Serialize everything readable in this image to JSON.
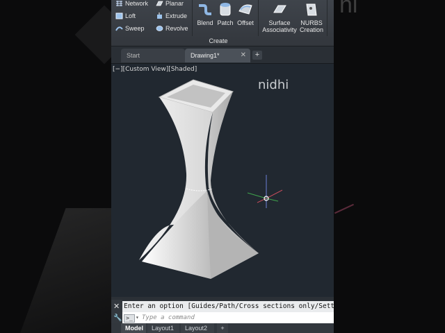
{
  "ribbon": {
    "left_items": [
      {
        "label": "Network",
        "icon": "network-icon"
      },
      {
        "label": "Loft",
        "icon": "loft-icon"
      },
      {
        "label": "Sweep",
        "icon": "sweep-icon"
      }
    ],
    "mid_items": [
      {
        "label": "Planar",
        "icon": "planar-icon"
      },
      {
        "label": "Extrude",
        "icon": "extrude-icon"
      },
      {
        "label": "Revolve",
        "icon": "revolve-icon"
      }
    ],
    "big_buttons": [
      {
        "label": "Blend",
        "icon": "blend-icon"
      },
      {
        "label": "Patch",
        "icon": "patch-icon"
      },
      {
        "label": "Offset",
        "icon": "offset-icon"
      },
      {
        "label_line1": "Surface",
        "label_line2": "Associativity",
        "icon": "surface-associativity-icon"
      },
      {
        "label_line1": "NURBS",
        "label_line2": "Creation",
        "icon": "nurbs-creation-icon"
      }
    ],
    "panel_title": "Create"
  },
  "tabs": {
    "start": "Start",
    "drawing": "Drawing1*",
    "close": "✕",
    "add": "+"
  },
  "viewport": {
    "label": "[−][Custom View][Shaded]",
    "watermark": "nidhi"
  },
  "command": {
    "history": "Enter an option [Guides/Path/Cross sections only/Settings]",
    "placeholder": "Type a command",
    "close": "✕",
    "customize": "🔧"
  },
  "layouts": {
    "model": "Model",
    "layout1": "Layout1",
    "layout2": "Layout2",
    "add": "+"
  },
  "ghost": {
    "text": "hi"
  },
  "colors": {
    "viewport_bg": "#212830",
    "ribbon_bg": "#3a3f45",
    "surface_accent": "#6fa8dc"
  }
}
